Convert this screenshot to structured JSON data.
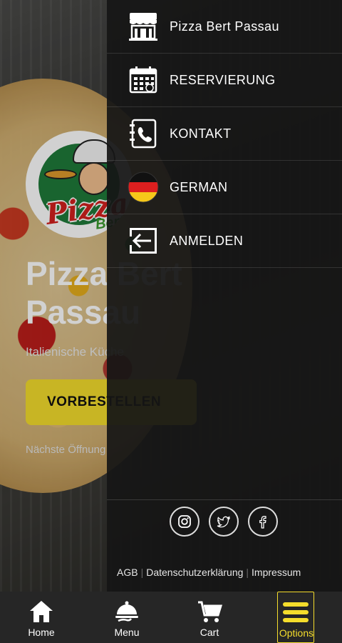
{
  "colors": {
    "accent": "#f5dd2c",
    "drawer_bg": "#161616",
    "tabbar_bg": "#262626"
  },
  "hero": {
    "title": "Pizza Bert\nPassau",
    "subtitle": "Italienische Küche",
    "order_button": "VORBESTELLEN",
    "next_open": "Nächste Öffnung"
  },
  "drawer": {
    "items": [
      {
        "label": "Pizza Bert Passau",
        "icon": "store-icon"
      },
      {
        "label": "RESERVIERUNG",
        "icon": "calendar-icon"
      },
      {
        "label": "KONTAKT",
        "icon": "contact-book-icon"
      },
      {
        "label": "GERMAN",
        "icon": "german-flag-icon"
      },
      {
        "label": "ANMELDEN",
        "icon": "login-icon"
      }
    ],
    "social": [
      "instagram-icon",
      "twitter-icon",
      "facebook-icon"
    ],
    "footer": {
      "agb": "AGB",
      "privacy": "Datenschutzerklärung",
      "imprint": "Impressum"
    }
  },
  "tabbar": {
    "tabs": [
      {
        "label": "Home",
        "icon": "home-icon"
      },
      {
        "label": "Menu",
        "icon": "cloche-icon"
      },
      {
        "label": "Cart",
        "icon": "cart-icon"
      },
      {
        "label": "Options",
        "icon": "hamburger-icon",
        "active": true
      }
    ]
  }
}
